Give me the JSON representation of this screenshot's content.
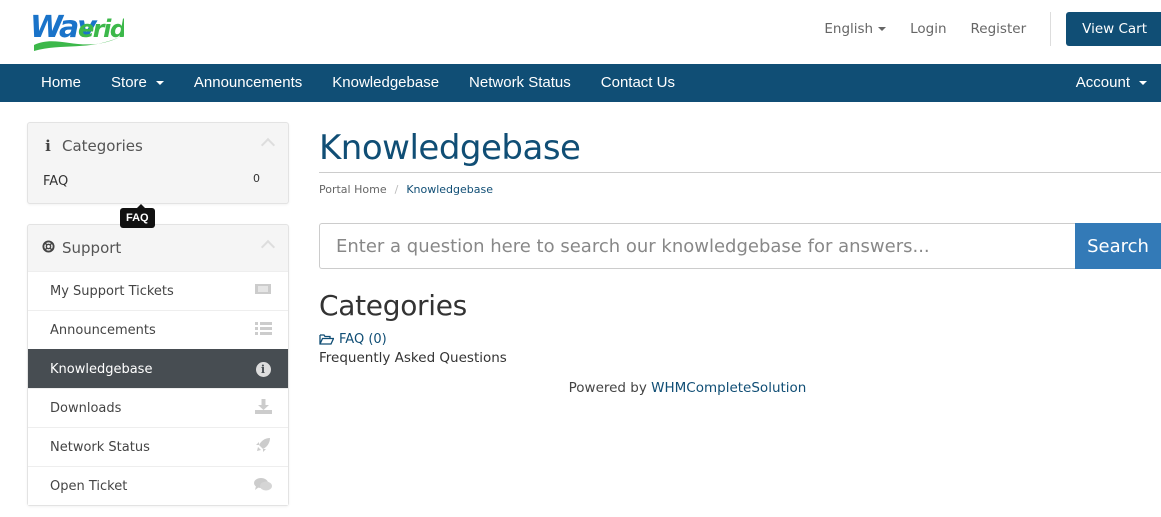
{
  "brand": {
    "logo_text": "Waveride",
    "accent": "#104e75",
    "logo_blue": "#1a73c9",
    "logo_green": "#3cb84a"
  },
  "topbar": {
    "language": "English",
    "login": "Login",
    "register": "Register",
    "view_cart": "View Cart"
  },
  "nav": {
    "items": [
      {
        "label": "Home",
        "dropdown": false
      },
      {
        "label": "Store",
        "dropdown": true
      },
      {
        "label": "Announcements",
        "dropdown": false
      },
      {
        "label": "Knowledgebase",
        "dropdown": false
      },
      {
        "label": "Network Status",
        "dropdown": false
      },
      {
        "label": "Contact Us",
        "dropdown": false
      }
    ],
    "account": "Account"
  },
  "sidebar": {
    "categories": {
      "title": "Categories",
      "items": [
        {
          "label": "FAQ",
          "count": "0"
        }
      ],
      "tooltip": "FAQ"
    },
    "support": {
      "title": "Support",
      "items": [
        {
          "label": "My Support Tickets",
          "icon": "ticket-icon"
        },
        {
          "label": "Announcements",
          "icon": "list-icon"
        },
        {
          "label": "Knowledgebase",
          "icon": "info-circle-icon",
          "active": true
        },
        {
          "label": "Downloads",
          "icon": "download-icon"
        },
        {
          "label": "Network Status",
          "icon": "rocket-icon"
        },
        {
          "label": "Open Ticket",
          "icon": "comments-icon"
        }
      ]
    }
  },
  "main": {
    "title": "Knowledgebase",
    "breadcrumb": [
      "Portal Home",
      "Knowledgebase"
    ],
    "search": {
      "placeholder": "Enter a question here to search our knowledgebase for answers...",
      "value": "",
      "button": "Search"
    },
    "categories_title": "Categories",
    "categories": [
      {
        "label": "FAQ (0)",
        "description": "Frequently Asked Questions"
      }
    ],
    "powered_by": "Powered by ",
    "powered_link": "WHMCompleteSolution"
  }
}
